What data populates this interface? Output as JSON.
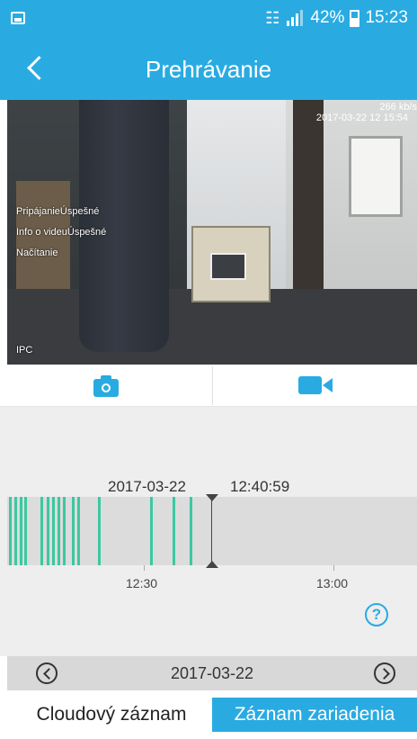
{
  "status_bar": {
    "battery": "42%",
    "time": "15:23"
  },
  "header": {
    "title": "Prehrávanie",
    "back_icon": "chevron-left-icon"
  },
  "video": {
    "overlay_lines": [
      "PripájanieÚspešné",
      "Info o videuÚspešné",
      "Načítanie"
    ],
    "camera_label": "IPC",
    "timestamp": "2017-03-22 12 15:54",
    "bitrate": "266 kb/s"
  },
  "actions": {
    "snapshot_icon": "camera-icon",
    "record_icon": "video-camera-icon"
  },
  "timeline": {
    "current_date": "2017-03-22",
    "current_time": "12:40:59",
    "tick_labels": [
      "12:30",
      "13:00"
    ],
    "segment_color": "#3cc8a0",
    "help_label": "?"
  },
  "date_nav": {
    "date": "2017-03-22"
  },
  "tabs": {
    "cloud": "Cloudový záznam",
    "device": "Záznam zariadenia",
    "active": "device"
  },
  "colors": {
    "accent": "#29ABE2"
  }
}
